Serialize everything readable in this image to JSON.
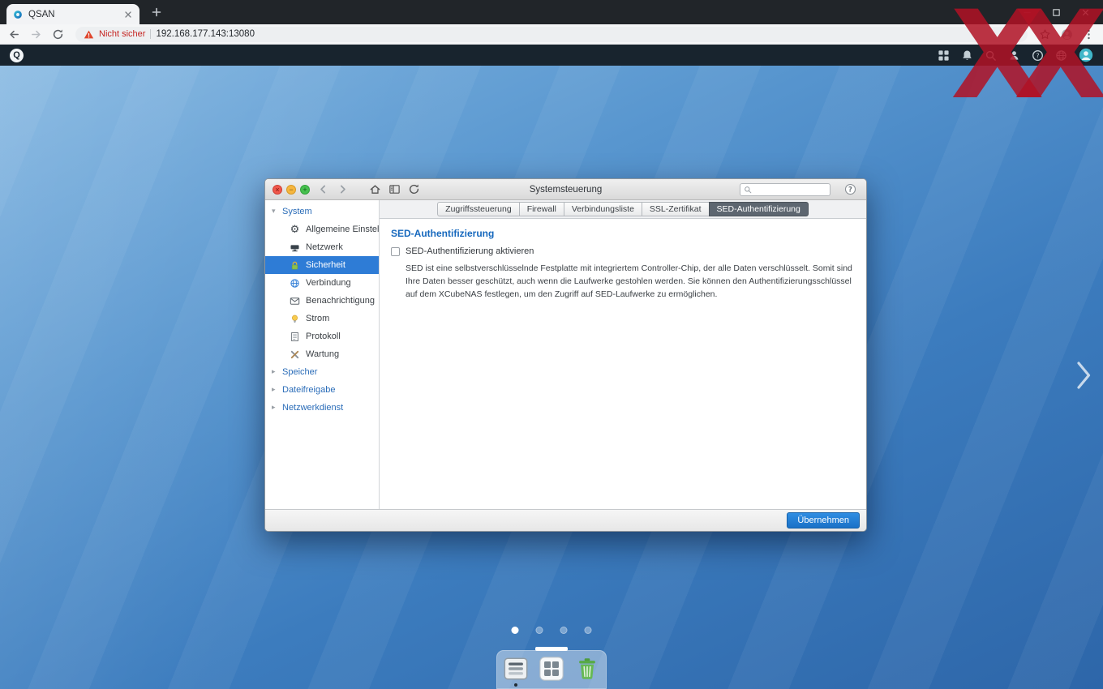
{
  "browser": {
    "tab_title": "QSAN",
    "security_label": "Nicht sicher",
    "url": "192.168.177.143:13080",
    "window_controls": [
      "minimize",
      "maximize",
      "close"
    ],
    "toolbar_actions": [
      "star",
      "profile",
      "menu"
    ]
  },
  "topbar": {
    "logo_text": "Q",
    "actions": [
      "apps",
      "notifications",
      "search",
      "user",
      "help",
      "language",
      "account"
    ]
  },
  "window": {
    "title": "Systemsteuerung",
    "controls": [
      {
        "name": "close",
        "glyph": "×"
      },
      {
        "name": "minimize",
        "glyph": "−"
      },
      {
        "name": "zoom",
        "glyph": "+"
      }
    ],
    "search_value": "",
    "tabs": [
      {
        "label": "Zugriffssteuerung",
        "active": false
      },
      {
        "label": "Firewall",
        "active": false
      },
      {
        "label": "Verbindungsliste",
        "active": false
      },
      {
        "label": "SSL-Zertifikat",
        "active": false
      },
      {
        "label": "SED-Authentifizierung",
        "active": true
      }
    ],
    "sidebar": {
      "sections": [
        {
          "label": "System",
          "expanded": true,
          "items": [
            {
              "label": "Allgemeine Einstellun...",
              "icon": "gear",
              "selected": false
            },
            {
              "label": "Netzwerk",
              "icon": "network",
              "selected": false
            },
            {
              "label": "Sicherheit",
              "icon": "lock",
              "selected": true
            },
            {
              "label": "Verbindung",
              "icon": "globe",
              "selected": false
            },
            {
              "label": "Benachrichtigung",
              "icon": "notification",
              "selected": false
            },
            {
              "label": "Strom",
              "icon": "power",
              "selected": false
            },
            {
              "label": "Protokoll",
              "icon": "log",
              "selected": false
            },
            {
              "label": "Wartung",
              "icon": "maintenance",
              "selected": false
            }
          ]
        },
        {
          "label": "Speicher",
          "expanded": false,
          "items": []
        },
        {
          "label": "Dateifreigabe",
          "expanded": false,
          "items": []
        },
        {
          "label": "Netzwerkdienst",
          "expanded": false,
          "items": []
        }
      ]
    },
    "content": {
      "heading": "SED-Authentifizierung",
      "checkbox_label": "SED-Authentifizierung aktivieren",
      "checkbox_checked": false,
      "description": "SED ist eine selbstverschlüsselnde Festplatte mit integriertem Controller-Chip, der alle Daten verschlüsselt. Somit sind Ihre Daten besser geschützt, auch wenn die Laufwerke gestohlen werden. Sie können den Authentifizierungsschlüssel auf dem XCubeNAS festlegen, um den Zugriff auf SED-Laufwerke zu ermöglichen."
    },
    "footer": {
      "apply_label": "Übernehmen"
    }
  },
  "desktop": {
    "pager": {
      "count": 4,
      "active": 0
    },
    "dock": [
      {
        "name": "control-panel",
        "open": true
      },
      {
        "name": "app-center",
        "open": false
      },
      {
        "name": "recycle-bin",
        "open": false
      }
    ]
  },
  "watermark": {
    "letters": [
      "X",
      "X"
    ]
  },
  "colors": {
    "accent": "#1f7fd6",
    "selected_item": "#2e7cd6",
    "watermark": "#b01225"
  }
}
